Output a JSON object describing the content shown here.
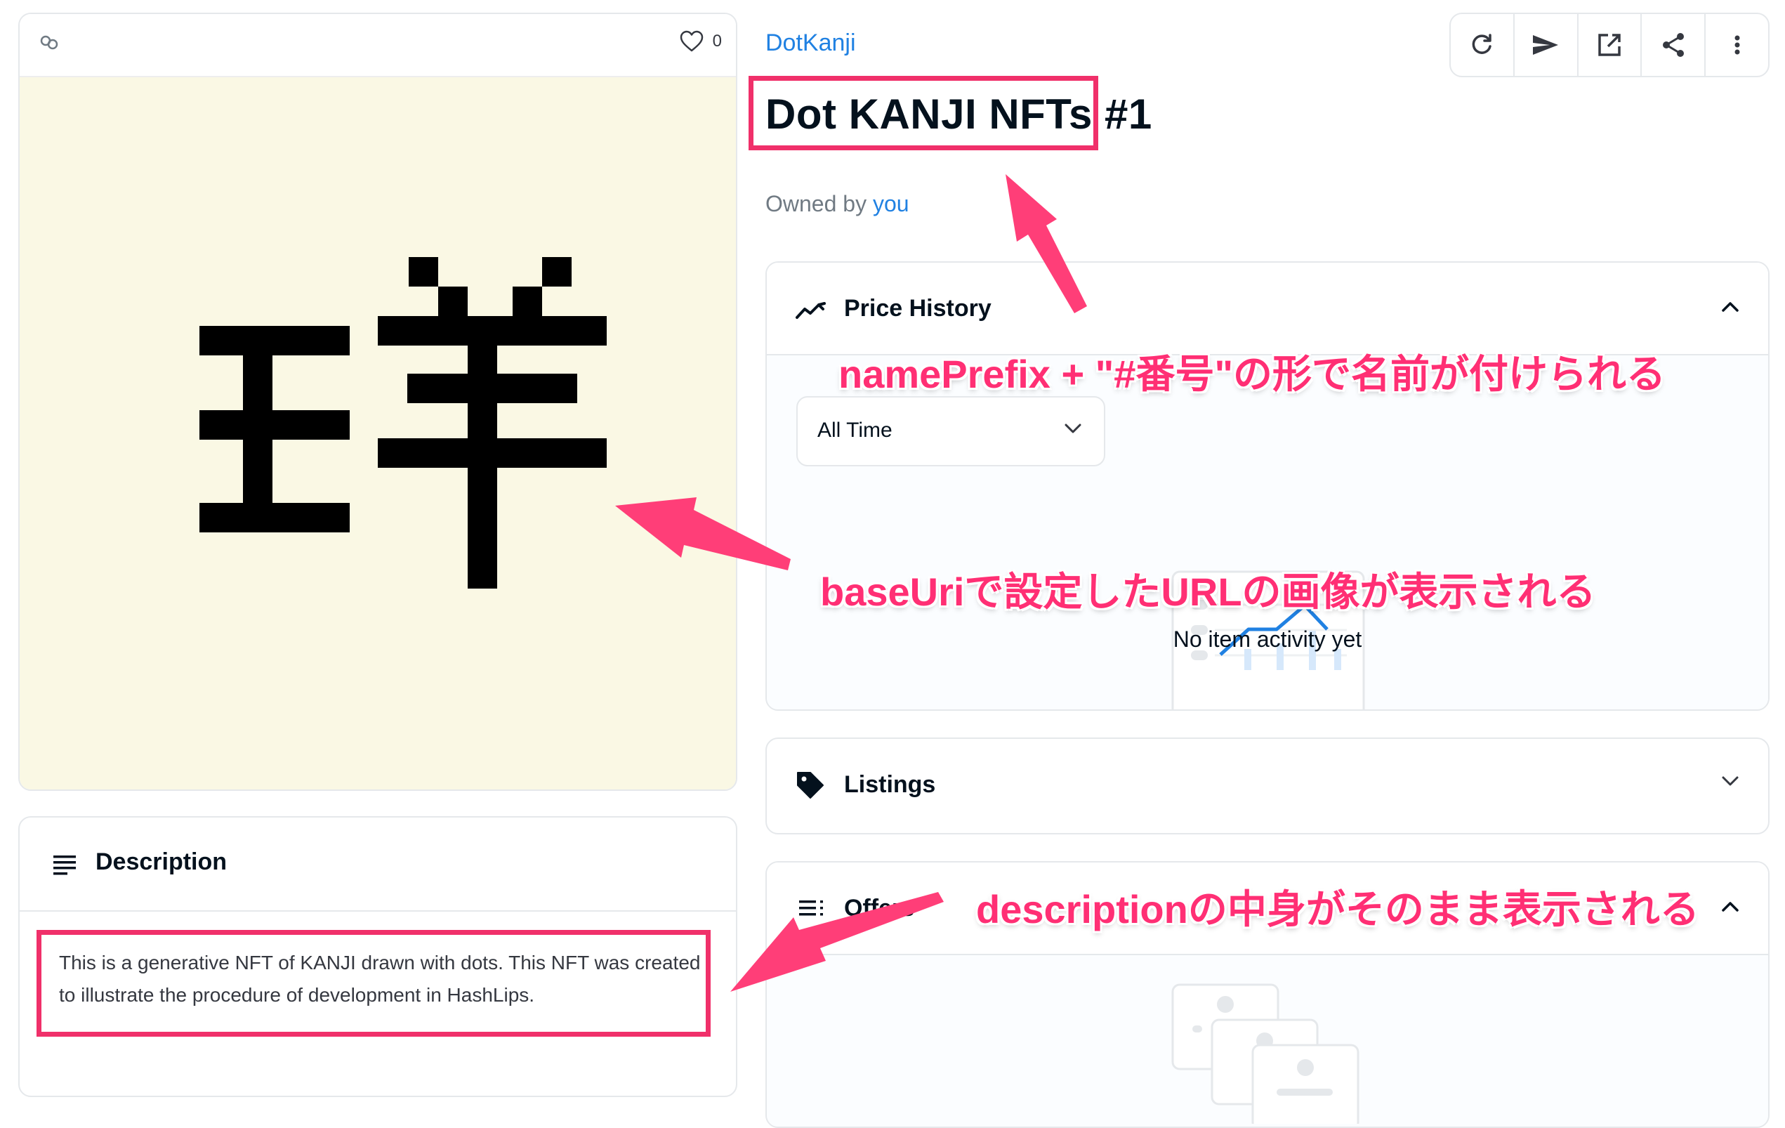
{
  "left_card": {
    "favorite_count": "0"
  },
  "description": {
    "title": "Description",
    "body": "This is a generative NFT of KANJI drawn with dots. This NFT was created to illustrate the procedure of development in HashLips."
  },
  "header": {
    "collection": "DotKanji",
    "title": "Dot KANJI NFTs #1",
    "owned_by_label": "Owned by",
    "owner": "you"
  },
  "toolbar": {
    "icons": [
      "refresh-icon",
      "send-icon",
      "external-link-icon",
      "share-icon",
      "more-icon"
    ]
  },
  "price_history": {
    "title": "Price History",
    "time_filter": "All Time",
    "empty_text": "No item activity yet"
  },
  "listings": {
    "title": "Listings"
  },
  "offers": {
    "title": "Offers"
  },
  "annotations": {
    "name_prefix_note": "namePrefix + \"#番号\"の形で名前が付けられる",
    "base_uri_note": "baseUriで設定したURLの画像が表示される",
    "description_note": "descriptionの中身がそのまま表示される"
  },
  "colors": {
    "accent": "#2081e2",
    "annotation": "#f0306a",
    "image_background": "#faf8e4",
    "chart_line": "#2081e2"
  }
}
